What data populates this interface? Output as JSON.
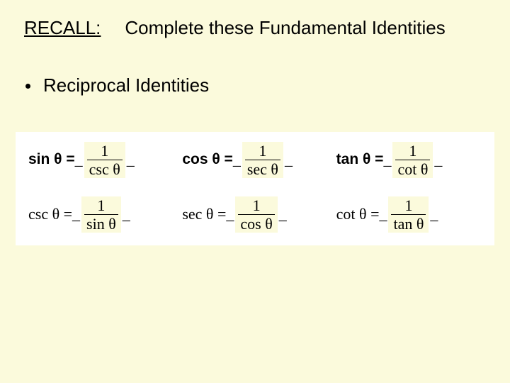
{
  "header": {
    "recall_label": "RECALL:",
    "title": "Complete these Fundamental Identities"
  },
  "bullet": {
    "label": "Reciprocal Identities"
  },
  "identities": {
    "row1": {
      "sin": {
        "lhs": "sin θ = ",
        "pre": "_",
        "num": "1",
        "den": "csc θ",
        "post": "_"
      },
      "cos": {
        "lhs": "cos θ = ",
        "pre": "_",
        "num": "1",
        "den": "sec θ",
        "post": "_"
      },
      "tan": {
        "lhs": "tan θ = ",
        "pre": "_",
        "num": "1",
        "den": "cot θ",
        "post": "_"
      }
    },
    "row2": {
      "csc": {
        "lhs": "csc θ = ",
        "pre": "_",
        "num": "1",
        "den": "sin θ",
        "post": "_"
      },
      "sec": {
        "lhs": "sec θ = ",
        "pre": "_",
        "num": "1",
        "den": "cos θ",
        "post": "_"
      },
      "cot": {
        "lhs": "cot θ = ",
        "pre": "_",
        "num": "1",
        "den": "tan θ",
        "post": "_"
      }
    }
  }
}
